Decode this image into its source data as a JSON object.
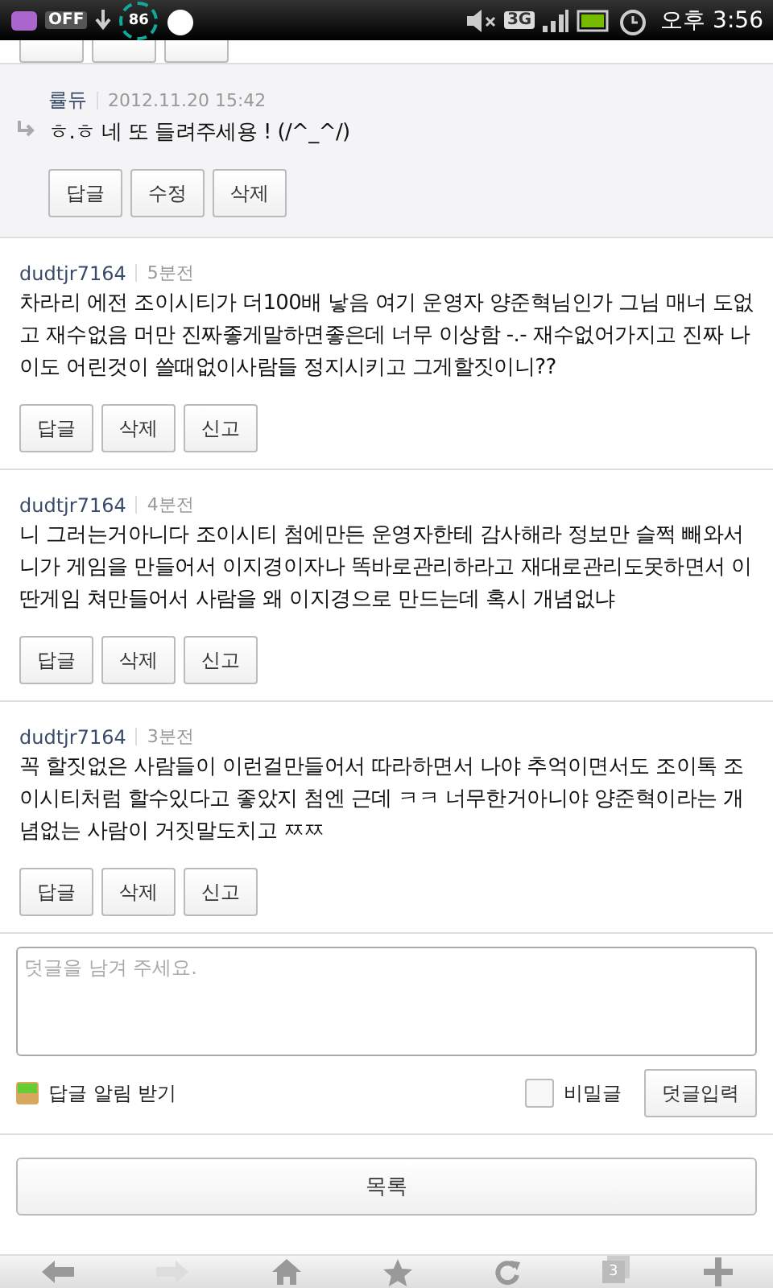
{
  "status_bar": {
    "off_badge": "OFF",
    "battery_percent": "86",
    "network": "3G",
    "time": "오후 3:56"
  },
  "reply": {
    "author": "률듀",
    "date": "2012.11.20 15:42",
    "text": "ㅎ.ㅎ 네 또 들려주세용 ! (/^_^/)",
    "actions": [
      "답글",
      "수정",
      "삭제"
    ]
  },
  "comments": [
    {
      "author": "dudtjr7164",
      "time": "5분전",
      "text": "차라리 에전 조이시티가 더100배  낳음 여기 운영자 양준혁님인가 그님 매너 도없고 재수없음 머만 진짜좋게말하면좋은데 너무 이상함 -.- 재수없어가지고 진짜 나이도 어린것이 쓸때없이사람들 정지시키고 그게할짓이니??",
      "actions": [
        "답글",
        "삭제",
        "신고"
      ]
    },
    {
      "author": "dudtjr7164",
      "time": "4분전",
      "text": "니 그러는거아니다 조이시티 첨에만든 운영자한테 감사해라 정보만 슬쩍 빼와서 니가 게임을 만들어서 이지경이자나 똑바로관리하라고 재대로관리도못하면서 이딴게임 쳐만들어서 사람을 왜 이지경으로 만드는데 혹시 개념없냐",
      "actions": [
        "답글",
        "삭제",
        "신고"
      ]
    },
    {
      "author": "dudtjr7164",
      "time": "3분전",
      "text": "꼭 할짓없은 사람들이 이런걸만들어서 따라하면서 나야 추억이면서도 조이톡 조이시티처럼 할수있다고 좋았지 첨엔 근데 ㅋㅋ 너무한거아니야 양준혁이라는 개념없는 사람이 거짓말도치고 ㅉㅉ",
      "actions": [
        "답글",
        "삭제",
        "신고"
      ]
    }
  ],
  "comment_form": {
    "placeholder": "덧글을 남겨 주세요.",
    "notify_label": "답글 알림 받기",
    "secret_label": "비밀글",
    "secret_checked": false,
    "submit": "덧글입력"
  },
  "list_button": "목록",
  "browser_bar": {
    "tab_count": "3"
  }
}
